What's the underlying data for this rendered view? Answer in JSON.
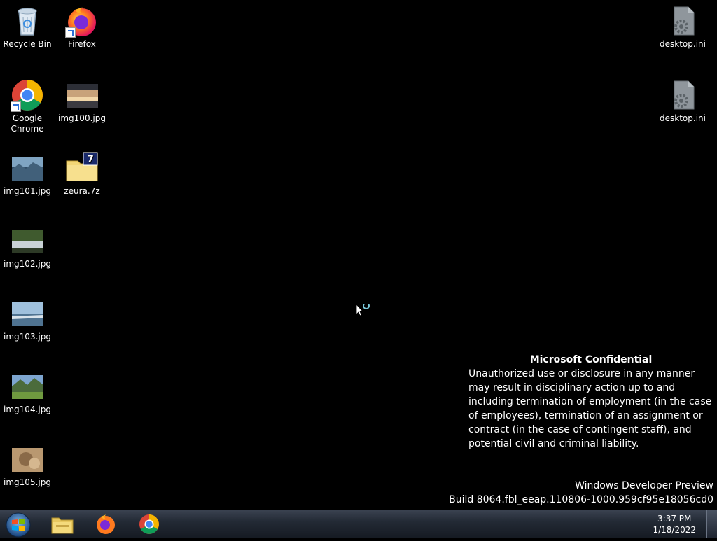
{
  "desktop": {
    "icons": [
      {
        "label": "Recycle Bin",
        "icon": "recycle-bin-icon"
      },
      {
        "label": "Firefox",
        "icon": "firefox-icon"
      },
      {
        "label": "Google Chrome",
        "icon": "chrome-icon"
      },
      {
        "label": "img100.jpg",
        "icon": "image-file-icon"
      },
      {
        "label": "img101.jpg",
        "icon": "image-file-icon"
      },
      {
        "label": "zeura.7z",
        "icon": "7zip-archive-icon"
      },
      {
        "label": "img102.jpg",
        "icon": "image-file-icon"
      },
      {
        "label": "img103.jpg",
        "icon": "image-file-icon"
      },
      {
        "label": "img104.jpg",
        "icon": "image-file-icon"
      },
      {
        "label": "img105.jpg",
        "icon": "image-file-icon"
      },
      {
        "label": "desktop.ini",
        "icon": "settings-file-icon"
      },
      {
        "label": "desktop.ini",
        "icon": "settings-file-icon"
      }
    ]
  },
  "watermark": {
    "title": "Microsoft Confidential",
    "body": "Unauthorized use or disclosure in any manner may result in disciplinary action up to and including termination of employment (in the case of employees), termination of an assignment or contract (in the case of contingent staff), and potential civil and criminal liability.",
    "product": "Windows Developer Preview",
    "build": "Build 8064.fbl_eeap.110806-1000.959cf95e18056cd0"
  },
  "taskbar": {
    "start_icon": "windows-start-icon",
    "pinned": [
      {
        "name": "file-explorer",
        "icon": "folder-icon"
      },
      {
        "name": "firefox",
        "icon": "firefox-icon"
      },
      {
        "name": "chrome",
        "icon": "chrome-icon"
      }
    ],
    "clock": {
      "time": "3:37 PM",
      "date": "1/18/2022"
    }
  },
  "colors": {
    "desktop_bg": "#000000",
    "taskbar": "#1e2430"
  }
}
